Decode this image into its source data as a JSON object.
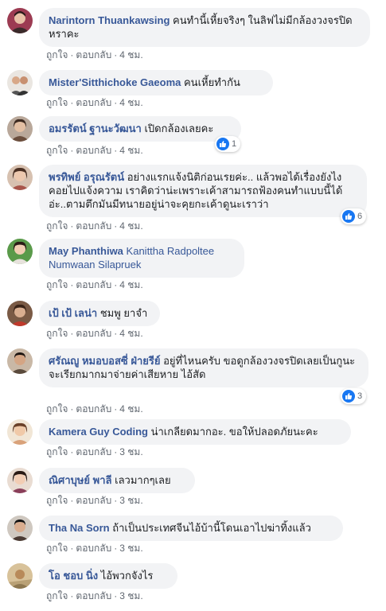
{
  "comments": [
    {
      "author": "Narintorn Thuankawsing",
      "text": "คนทำนี้เหี้ยจริงๆ ในลิฟไม่มีกล้องวงจรปิดหราคะ",
      "actions": {
        "like": "ถูกใจ",
        "reply": "ตอบกลับ",
        "time": "4 ชม."
      },
      "avatar_color": "#9c3b52"
    },
    {
      "author": "Mister'Sitthichoke Gaeoma",
      "text": "คนเหี้ยทำกัน",
      "actions": {
        "like": "ถูกใจ",
        "reply": "ตอบกลับ",
        "time": "4 ชม."
      },
      "avatar_color": "#c98d6e"
    },
    {
      "author": "อมรรัตน์ ฐานะวัฒนา",
      "text": "เปิดกล้องเลยคะ",
      "actions": {
        "like": "ถูกใจ",
        "reply": "ตอบกลับ",
        "time": "4 ชม."
      },
      "reaction_count": "1",
      "avatar_color": "#6b4e3d"
    },
    {
      "author": "พรทิพย์ อรุณรัตน์",
      "text": "อย่างแรกแจ้งนิติก่อนเรยค่ะ.. แล้วพอได้เรื่องยังไงคอยไปแจ้งความ เราคิดว่าน่ะเพราะเค้าสามารถฟ้องคนทำแบบนี้ได้อ่ะ..ตามตึกมันมีทนายอยู่น่าจะคุยกะเค้าดูนะเราว่า",
      "actions": {
        "like": "ถูกใจ",
        "reply": "ตอบกลับ",
        "time": "4 ชม."
      },
      "reaction_count": "6",
      "avatar_color": "#a8554a"
    },
    {
      "author": "May Phanthiwa",
      "tag": "Kanittha Radpoltee Numwaan Silapruek",
      "actions": {
        "like": "ถูกใจ",
        "reply": "ตอบกลับ",
        "time": "4 ชม."
      },
      "avatar_color": "#3f8a3a"
    },
    {
      "author": "เป้ เป้ เลน่า",
      "text": "ชมพู ยาจำ",
      "actions": {
        "like": "ถูกใจ",
        "reply": "ตอบกลับ",
        "time": "4 ชม."
      },
      "avatar_color": "#7a5a45"
    },
    {
      "author": "ศรัณญู หมอบอสซี่ ฝ่ายรีย์",
      "text": "อยู่ที่ไหนครับ ขอดูกล้องวงจรปิดเลยเป็นกูนะจะเรียกมากมาจ่ายค่าเสียหาย ไอ้สัด",
      "actions": {
        "like": "ถูกใจ",
        "reply": "ตอบกลับ",
        "time": "4 ชม."
      },
      "reaction_count": "3",
      "avatar_color": "#5a4a3c"
    },
    {
      "author": "Kamera Guy Coding",
      "text": "น่าเกลียดมากอะ. ขอให้ปลอดภัยนะคะ",
      "actions": {
        "like": "ถูกใจ",
        "reply": "ตอบกลับ",
        "time": "3 ชม."
      },
      "avatar_color": "#d9a27a"
    },
    {
      "author": "ณิศาบุษย์ พาลี",
      "text": "เลวมากๆเลย",
      "actions": {
        "like": "ถูกใจ",
        "reply": "ตอบกลับ",
        "time": "3 ชม."
      },
      "avatar_color": "#8a3f5a"
    },
    {
      "author": "Tha Na Sorn",
      "text": "ถ้าเป็นประเทศจีนไอ้บ้านี้โดนเอาไปฆ่าทิ้งแล้ว",
      "actions": {
        "like": "ถูกใจ",
        "reply": "ตอบกลับ",
        "time": "3 ชม."
      },
      "avatar_color": "#4a3a33"
    },
    {
      "author": "โอ ชอบ นิ่ง",
      "text": "ไอ้พวกจังไร",
      "actions": {
        "like": "ถูกใจ",
        "reply": "ตอบกลับ",
        "time": "3 ชม."
      },
      "avatar_color": "#b88a5a"
    }
  ],
  "separator": "·",
  "colors": {
    "author_link": "#385898",
    "bubble_bg": "#f2f3f5",
    "meta_text": "#606770",
    "like_icon": "#1877f2"
  },
  "icons": {
    "reaction": "thumbs-up-icon"
  }
}
